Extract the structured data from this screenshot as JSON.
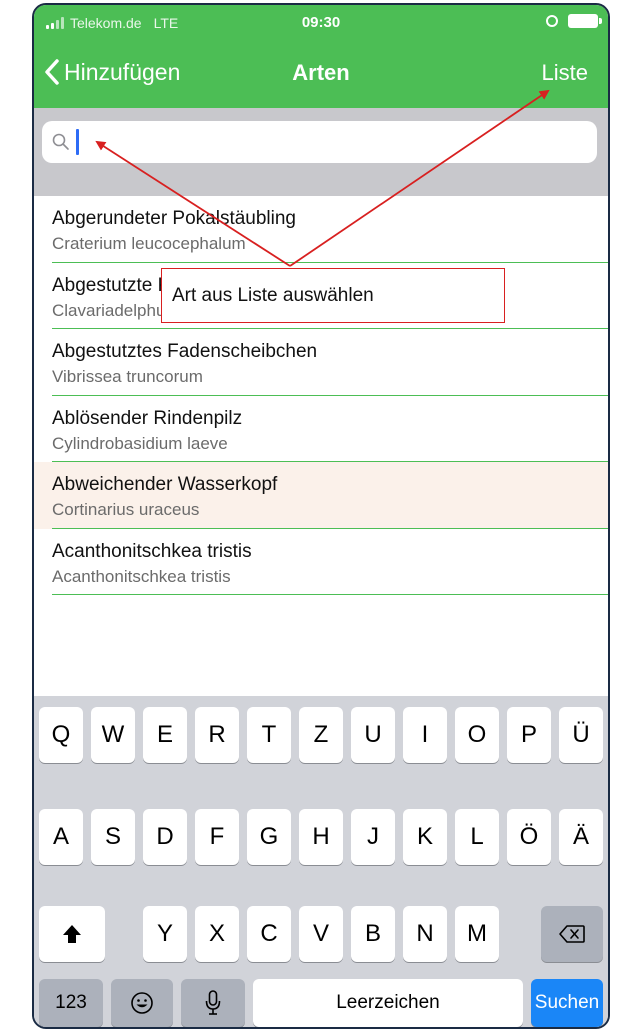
{
  "status": {
    "carrier": "Telekom.de",
    "network": "LTE",
    "time": "09:30"
  },
  "nav": {
    "back_label": "Hinzufügen",
    "title": "Arten",
    "action_label": "Liste"
  },
  "search": {
    "value": ""
  },
  "species": [
    {
      "name": "Abgerundeter Pokalstäubling",
      "scientific": "Craterium leucocephalum"
    },
    {
      "name": "Abgestutzte Keule",
      "scientific": "Clavariadelphus truncatus"
    },
    {
      "name": "Abgestutztes Fadenscheibchen",
      "scientific": "Vibrissea truncorum"
    },
    {
      "name": "Ablösender Rindenpilz",
      "scientific": "Cylindrobasidium laeve"
    },
    {
      "name": "Abweichender Wasserkopf",
      "scientific": "Cortinarius uraceus"
    },
    {
      "name": "Acanthonitschkea tristis",
      "scientific": "Acanthonitschkea tristis"
    }
  ],
  "keyboard": {
    "row1": [
      "Q",
      "W",
      "E",
      "R",
      "T",
      "Z",
      "U",
      "I",
      "O",
      "P",
      "Ü"
    ],
    "row2": [
      "A",
      "S",
      "D",
      "F",
      "G",
      "H",
      "J",
      "K",
      "L",
      "Ö",
      "Ä"
    ],
    "row3": [
      "Y",
      "X",
      "C",
      "V",
      "B",
      "N",
      "M"
    ],
    "numbers_label": "123",
    "space_label": "Leerzeichen",
    "search_label": "Suchen"
  },
  "annotation": {
    "text": "Art aus Liste auswählen"
  },
  "colors": {
    "nav_green": "#4cbe55",
    "highlight_row": "#fbf1ea",
    "annotation_red": "#d82020",
    "key_blue": "#1a86f7"
  }
}
